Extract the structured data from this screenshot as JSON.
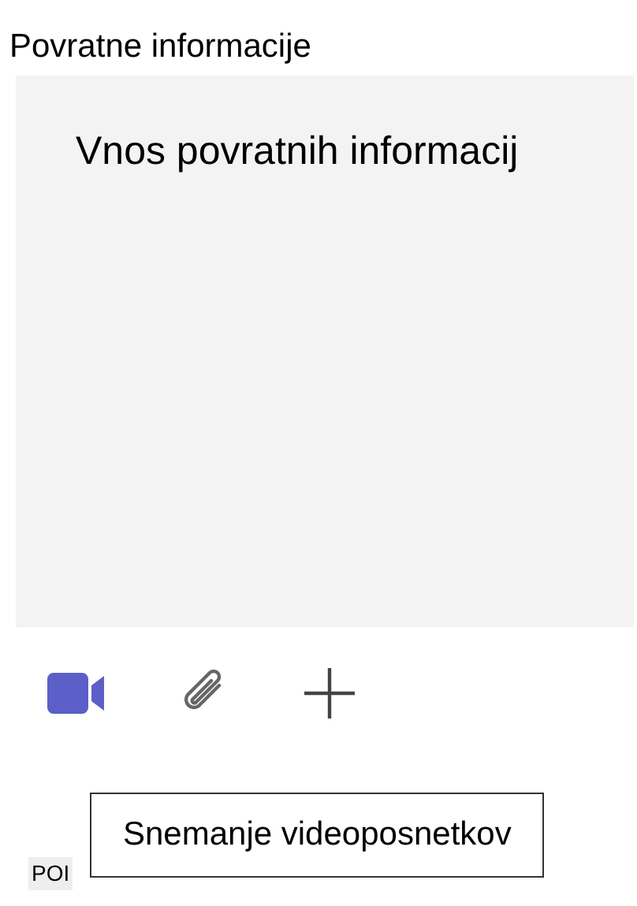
{
  "feedback": {
    "label": "Povratne informacije",
    "placeholder": "Vnos povratnih informacij"
  },
  "toolbar": [
    {
      "kind": "video"
    },
    {
      "kind": "attach"
    },
    {
      "kind": "add"
    }
  ],
  "tooltip": "Snemanje videoposnetkov",
  "badge": "POI"
}
